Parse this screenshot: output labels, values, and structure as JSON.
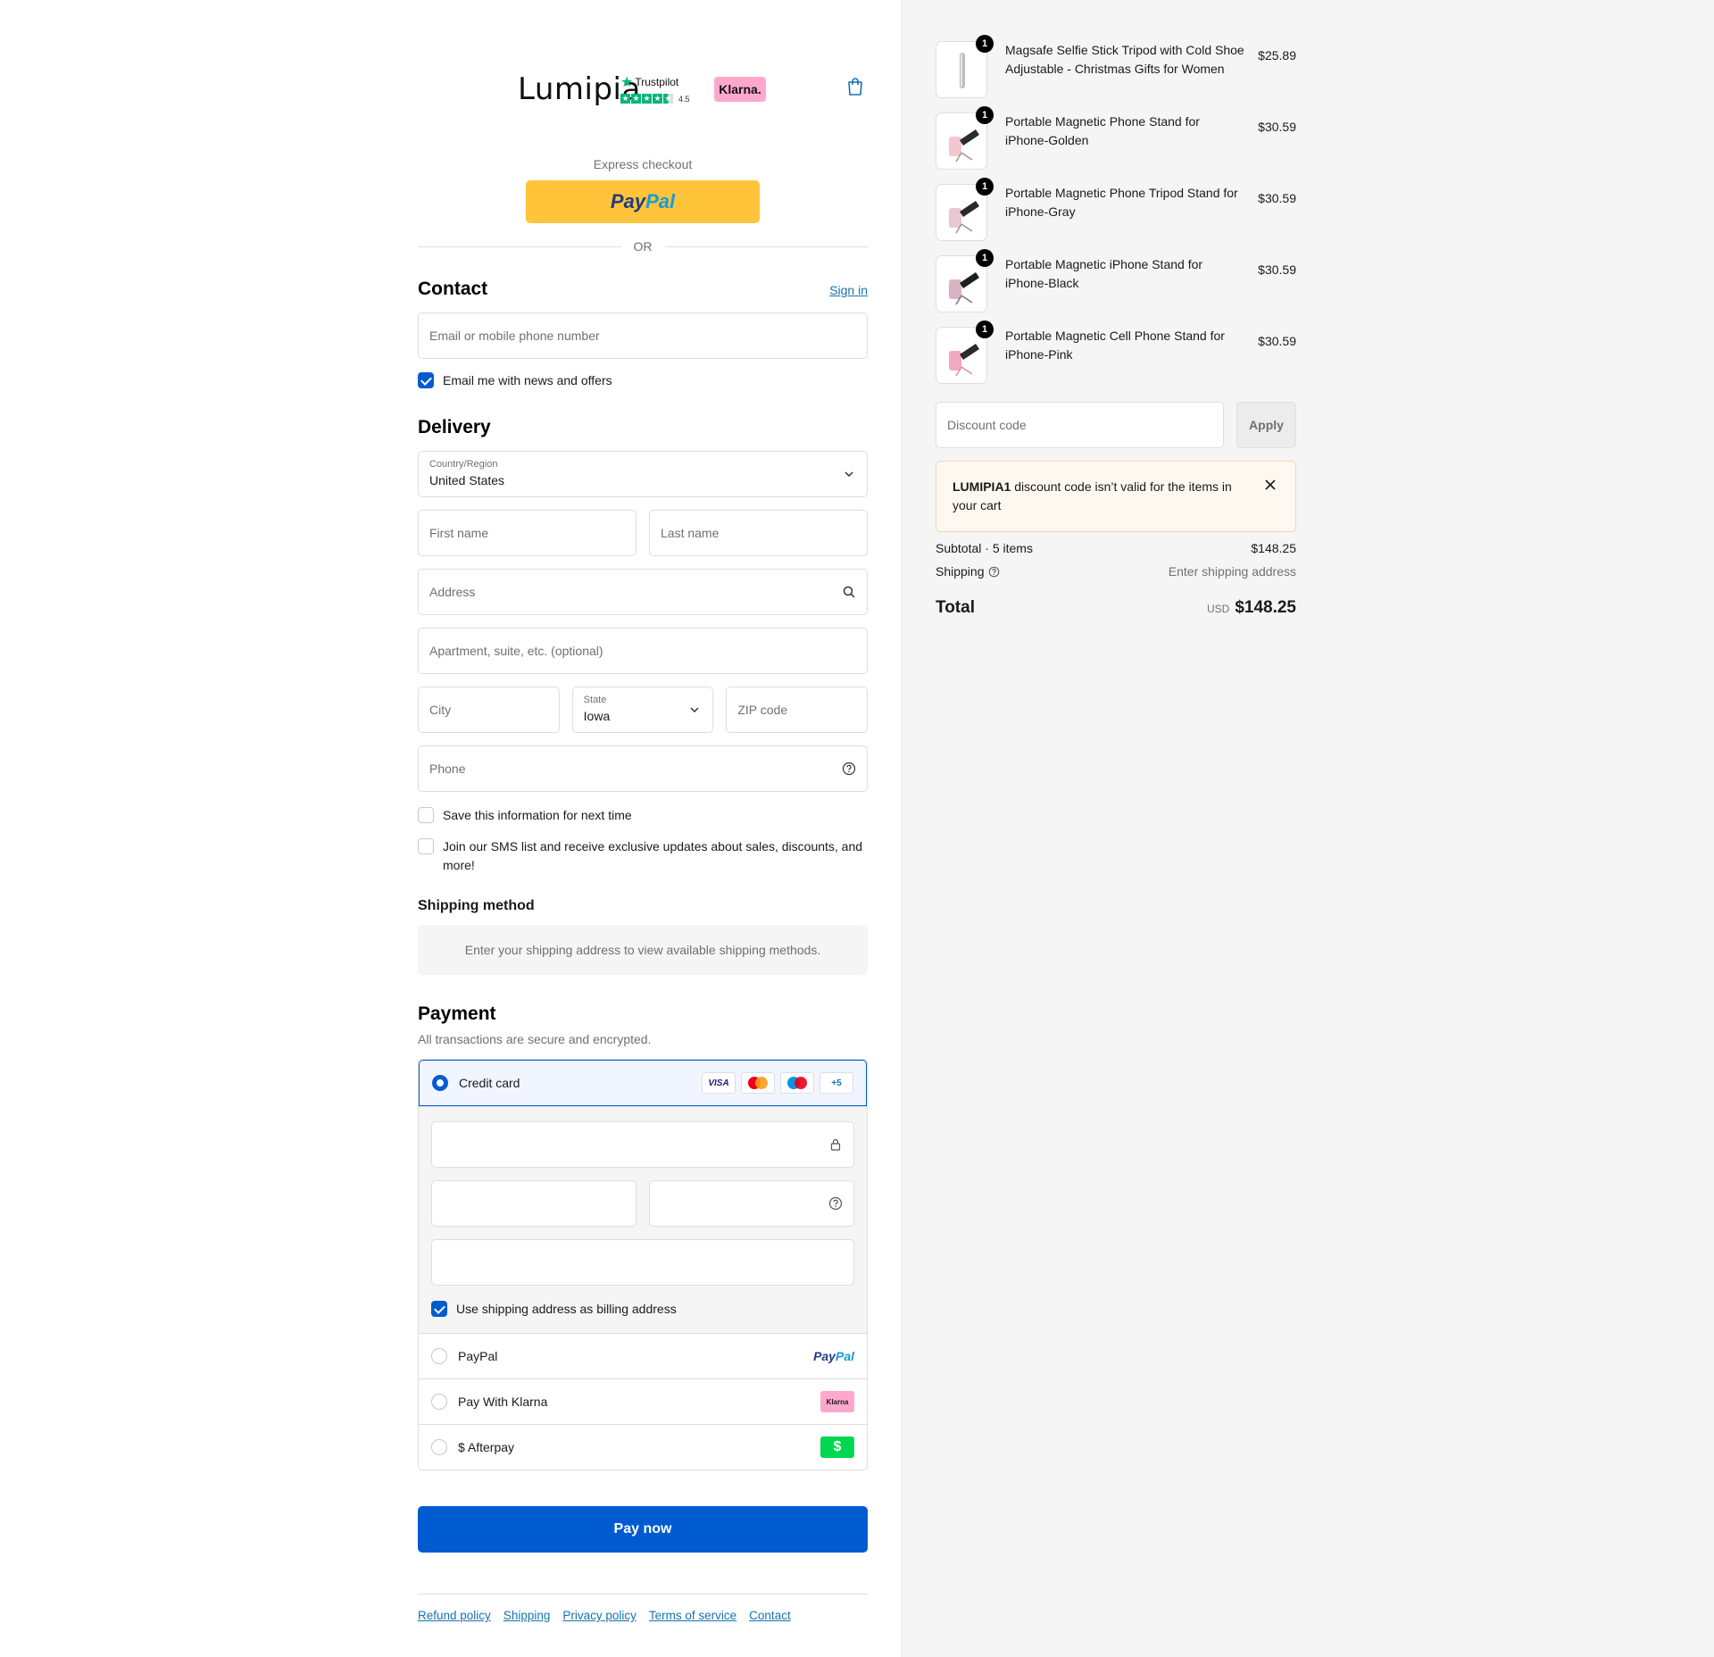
{
  "header": {
    "brand": "Lumipia",
    "trustpilot_name": "Trustpilot",
    "trustpilot_score": "4.5",
    "klarna": "Klarna."
  },
  "express": {
    "label": "Express checkout",
    "paypal_a": "Pay",
    "paypal_b": "Pal",
    "or": "OR"
  },
  "contact": {
    "title": "Contact",
    "sign_in": "Sign in",
    "email_placeholder": "Email or mobile phone number",
    "news_label": "Email me with news and offers",
    "news_checked": true
  },
  "delivery": {
    "title": "Delivery",
    "country_label": "Country/Region",
    "country_value": "United States",
    "first_name": "First name",
    "last_name": "Last name",
    "address": "Address",
    "apartment": "Apartment, suite, etc. (optional)",
    "city": "City",
    "state_label": "State",
    "state_value": "Iowa",
    "zip": "ZIP code",
    "phone": "Phone",
    "save_info": "Save this information for next time",
    "sms": "Join our SMS list and receive exclusive updates about sales, discounts, and more!"
  },
  "shipping_method": {
    "title": "Shipping method",
    "message": "Enter your shipping address to view available shipping methods."
  },
  "payment": {
    "title": "Payment",
    "subtitle": "All transactions are secure and encrypted.",
    "credit_card": "Credit card",
    "card_logos": [
      "VISA",
      "",
      "",
      "+5"
    ],
    "billing_same": "Use shipping address as billing address",
    "paypal": "PayPal",
    "klarna": "Pay With Klarna",
    "klarna_badge": "Klarna",
    "afterpay": "$ Afterpay",
    "afterpay_badge": "$",
    "pay_now": "Pay now"
  },
  "footer": {
    "links": [
      "Refund policy",
      "Shipping",
      "Privacy policy",
      "Terms of service",
      "Contact"
    ]
  },
  "cart": {
    "items": [
      {
        "qty": "1",
        "name": "Magsafe Selfie Stick Tripod with Cold Shoe Adjustable - Christmas Gifts for Women",
        "price": "$25.89"
      },
      {
        "qty": "1",
        "name": "Portable Magnetic Phone Stand for iPhone-Golden",
        "price": "$30.59"
      },
      {
        "qty": "1",
        "name": "Portable Magnetic Phone Tripod Stand for iPhone-Gray",
        "price": "$30.59"
      },
      {
        "qty": "1",
        "name": "Portable Magnetic iPhone Stand for iPhone-Black",
        "price": "$30.59"
      },
      {
        "qty": "1",
        "name": "Portable Magnetic Cell Phone Stand for iPhone-Pink",
        "price": "$30.59"
      }
    ],
    "discount_placeholder": "Discount code",
    "apply": "Apply",
    "alert_code": "LUMIPIA1",
    "alert_text": " discount code isn’t valid for the items in your cart",
    "subtotal_label": "Subtotal · 5 items",
    "subtotal_value": "$148.25",
    "shipping_label": "Shipping",
    "shipping_value": "Enter shipping address",
    "total_label": "Total",
    "currency": "USD",
    "total_value": "$148.25"
  },
  "colors": {
    "primary": "#005bd1",
    "link": "#1773b0",
    "paypal": "#ffc439",
    "klarna": "#ffa8cd",
    "afterpay": "#00d64f",
    "trustpilot": "#00b67a"
  }
}
